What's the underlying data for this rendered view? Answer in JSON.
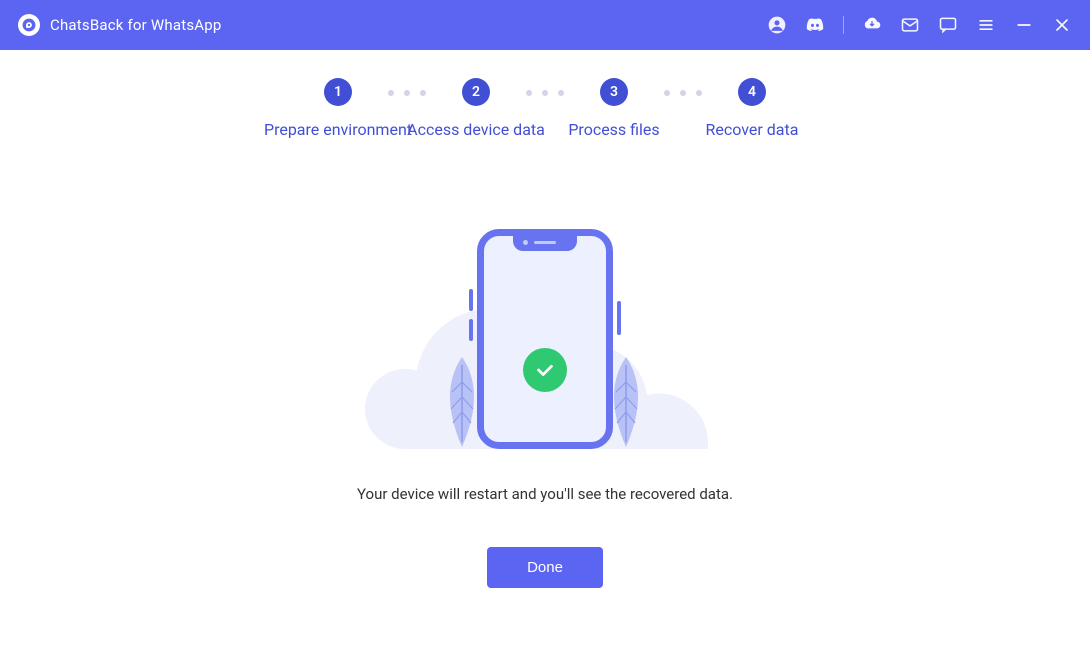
{
  "header": {
    "title": "ChatsBack for WhatsApp",
    "icons": {
      "account": "account-icon",
      "discord": "discord-icon",
      "cloud": "cloud-icon",
      "mail": "mail-icon",
      "feedback": "feedback-icon",
      "menu": "menu-icon",
      "minimize": "minimize-icon",
      "close": "close-icon"
    }
  },
  "steps": [
    {
      "num": "1",
      "label": "Prepare environment"
    },
    {
      "num": "2",
      "label": "Access device data"
    },
    {
      "num": "3",
      "label": "Process files"
    },
    {
      "num": "4",
      "label": "Recover data"
    }
  ],
  "status": {
    "message": "Your device will restart and you'll see the recovered data.",
    "button_label": "Done"
  },
  "colors": {
    "accent": "#5c64f2",
    "success": "#2ec971"
  }
}
